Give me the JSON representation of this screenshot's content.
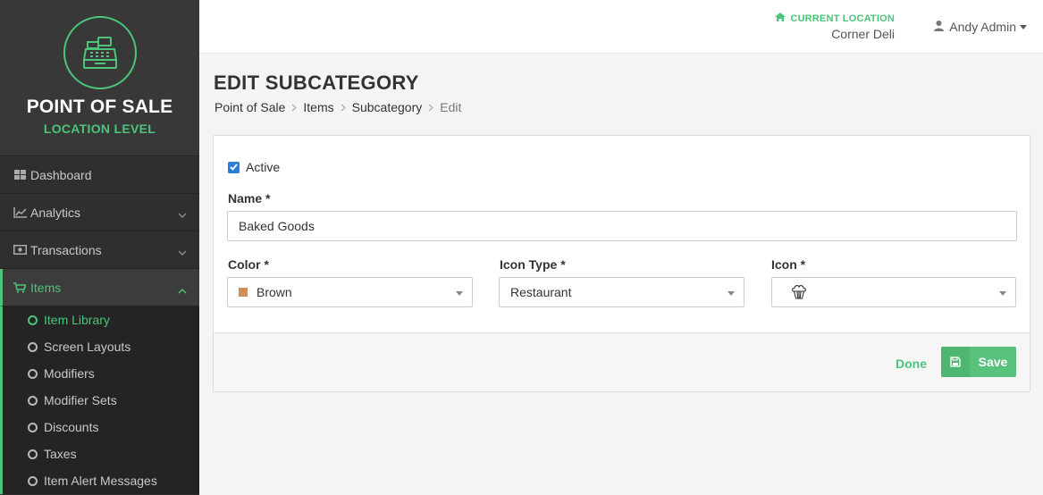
{
  "brand": {
    "title": "POINT OF SALE",
    "subtitle": "LOCATION LEVEL"
  },
  "nav": {
    "items": [
      {
        "label": "Dashboard",
        "icon": "dashboard-icon"
      },
      {
        "label": "Analytics",
        "icon": "line-chart-icon"
      },
      {
        "label": "Transactions",
        "icon": "money-icon"
      },
      {
        "label": "Items",
        "icon": "cart-icon"
      }
    ],
    "sub_items": [
      {
        "label": "Item Library"
      },
      {
        "label": "Screen Layouts"
      },
      {
        "label": "Modifiers"
      },
      {
        "label": "Modifier Sets"
      },
      {
        "label": "Discounts"
      },
      {
        "label": "Taxes"
      },
      {
        "label": "Item Alert Messages"
      }
    ]
  },
  "topbar": {
    "location_label": "CURRENT LOCATION",
    "location_value": "Corner Deli",
    "user_name": "Andy Admin"
  },
  "page": {
    "title": "EDIT SUBCATEGORY",
    "breadcrumb": [
      "Point of Sale",
      "Items",
      "Subcategory",
      "Edit"
    ]
  },
  "form": {
    "active_label": "Active",
    "active_checked": true,
    "name_label": "Name *",
    "name_value": "Baked Goods",
    "color_label": "Color *",
    "color_value": "Brown",
    "color_swatch": "#d1905a",
    "icon_type_label": "Icon Type *",
    "icon_type_value": "Restaurant",
    "icon_label": "Icon *",
    "icon_value": "cupcake-icon",
    "done_label": "Done",
    "save_label": "Save"
  },
  "colors": {
    "accent": "#4cc47a",
    "sidebar": "#2f2f2f",
    "checkbox": "#2b7fd8"
  }
}
